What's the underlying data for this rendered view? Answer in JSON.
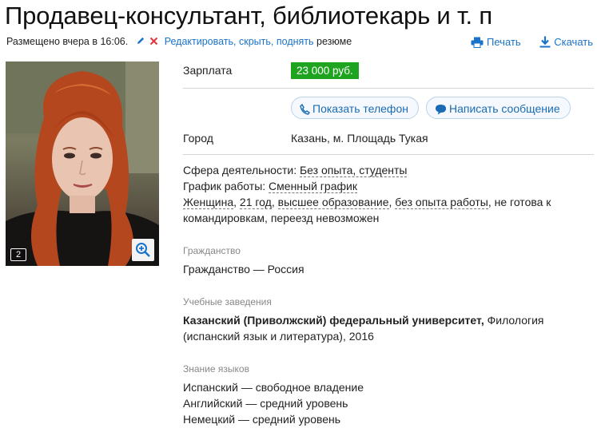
{
  "header": {
    "title": "Продавец-консультант, библиотекарь и т. п",
    "posted": "Размещено вчера в 16:06.",
    "edit_link": "Редактировать",
    "hide_link": "скрыть",
    "raise_link": "поднять",
    "resume_word": "резюме",
    "sep": ",",
    "print": "Печать",
    "download": "Скачать"
  },
  "photo": {
    "count": "2"
  },
  "salary": {
    "label": "Зарплата",
    "value": "23 000 руб."
  },
  "actions": {
    "show_phone": "Показать телефон",
    "write_message": "Написать сообщение"
  },
  "city": {
    "label": "Город",
    "value": "Казань, м. Площадь Тукая"
  },
  "details": {
    "sphere_label": "Сфера деятельности:",
    "sphere_value": "Без опыта, студенты",
    "schedule_label": "График работы:",
    "schedule_value": "Сменный график",
    "gender": "Женщина",
    "age": "21 год",
    "education": "высшее образование",
    "experience": "без опыта работы",
    "trips": "не готова к командировкам, переезд невозможен"
  },
  "citizenship": {
    "heading": "Гражданство",
    "value": "Гражданство — Россия"
  },
  "education": {
    "heading": "Учебные заведения",
    "institution": "Казанский (Приволжский) федеральный университет,",
    "details": "Филология (испанский язык и литература), 2016"
  },
  "languages": {
    "heading": "Знание языков",
    "items": [
      "Испанский — свободное владение",
      "Английский — средний уровень",
      "Немецкий — средний уровень"
    ]
  },
  "colors": {
    "accent": "#1a73c9",
    "salary": "#1fa41f",
    "delete": "#e8333a"
  }
}
